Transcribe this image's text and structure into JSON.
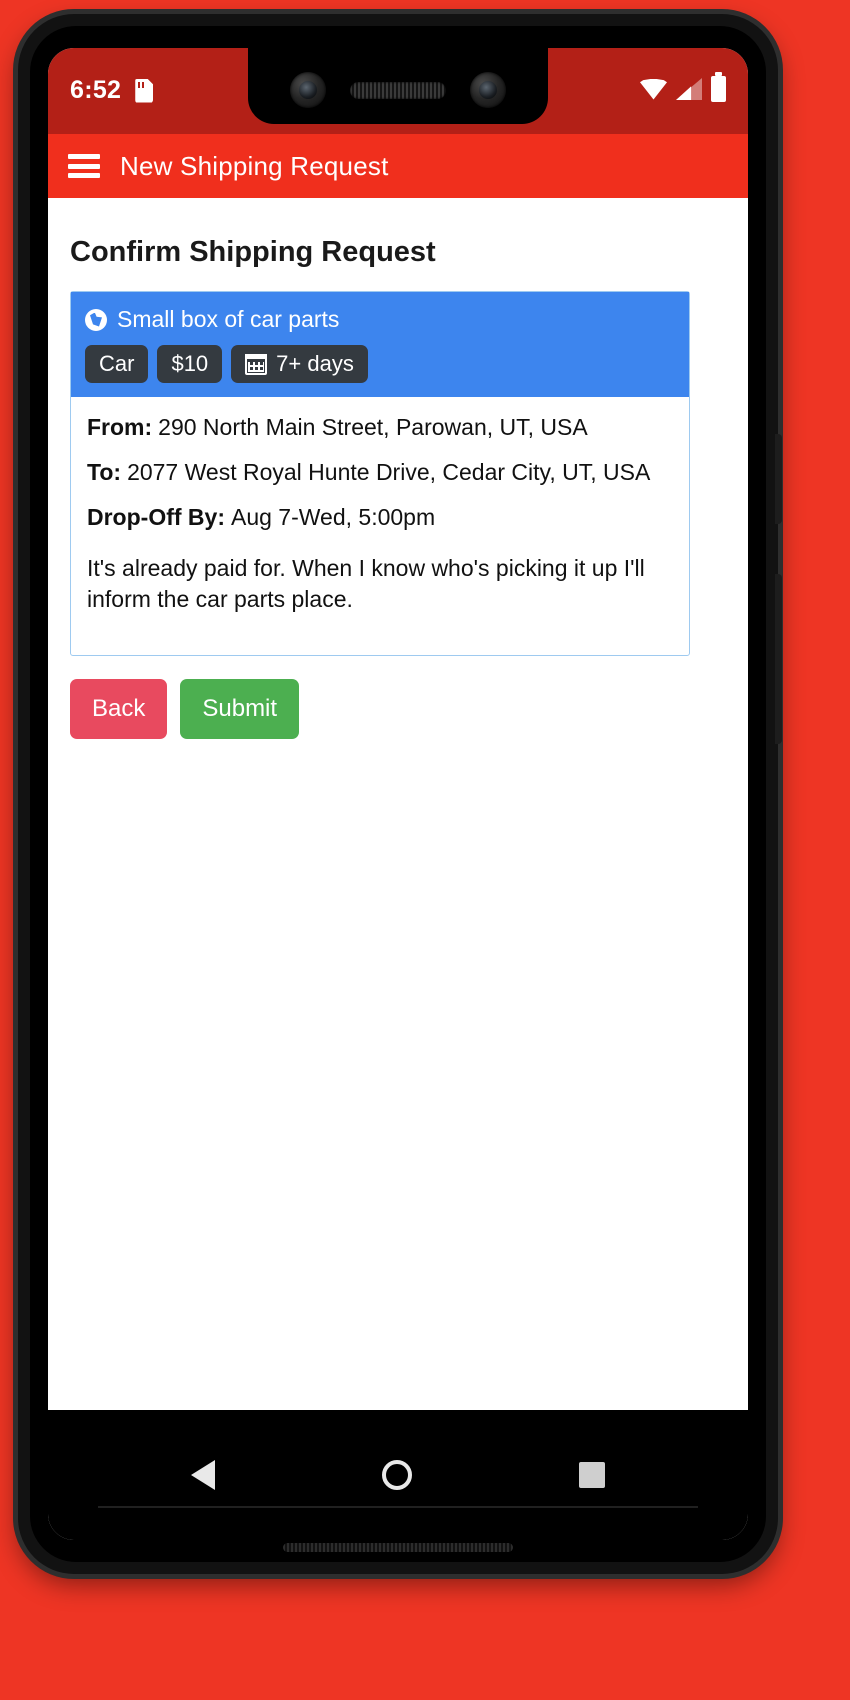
{
  "status_bar": {
    "time": "6:52",
    "icons": [
      "sdcard-icon",
      "wifi-icon",
      "signal-icon",
      "battery-icon"
    ],
    "background": "#b32017"
  },
  "app_bar": {
    "menu_icon": "hamburger-menu-icon",
    "title": "New Shipping Request",
    "background": "#f02f1d"
  },
  "page": {
    "title": "Confirm Shipping Request"
  },
  "card": {
    "header": {
      "icon": "globe-icon",
      "title": "Small box of car parts",
      "background": "#3d85ee",
      "badges": [
        {
          "label": "Car",
          "icon": null
        },
        {
          "label": "$10",
          "icon": null
        },
        {
          "label": "7+ days",
          "icon": "calendar-icon"
        }
      ]
    },
    "details": [
      {
        "label": "From:",
        "value": "290 North Main Street, Parowan, UT, USA"
      },
      {
        "label": "To:",
        "value": "2077 West Royal Hunte Drive, Cedar City, UT, USA"
      },
      {
        "label": "Drop-Off By:",
        "value": "Aug 7-Wed, 5:00pm"
      }
    ],
    "note": "It's already paid for.  When I know who's picking it up I'll inform the car parts place."
  },
  "actions": {
    "back_label": "Back",
    "back_color": "#e84a5f",
    "submit_label": "Submit",
    "submit_color": "#4caf50"
  },
  "nav_bar": {
    "back_icon": "nav-back-triangle-icon",
    "home_icon": "nav-home-circle-icon",
    "recents_icon": "nav-recents-square-icon"
  }
}
